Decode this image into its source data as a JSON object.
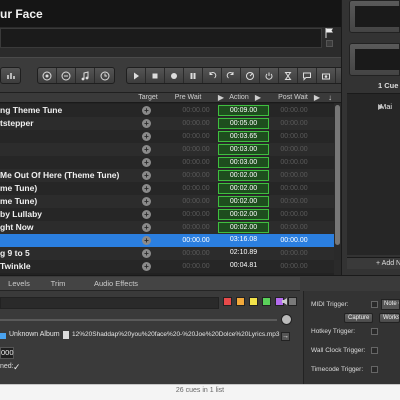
{
  "cue_title": "ur Face",
  "toolbar": {
    "groups": [
      [
        "equalizer-icon"
      ],
      [
        "target-icon",
        "audio-icon",
        "music-note-icon",
        "clock-icon"
      ],
      [
        "play-icon",
        "stop-icon",
        "record-icon",
        "pause-icon",
        "undo-icon",
        "redo-icon",
        "devamp-icon",
        "power-icon",
        "timer-icon",
        "chat-icon",
        "camera-icon",
        "script-icon"
      ]
    ]
  },
  "table": {
    "headers": {
      "target": "Target",
      "pre_wait": "Pre Wait",
      "action": "Action",
      "post_wait": "Post Wait"
    },
    "rows": [
      {
        "name": "ng Theme Tune",
        "pre": "00:00.00",
        "action": "00:09.00",
        "post": "00:00.00",
        "green": true,
        "selected": false
      },
      {
        "name": "tstepper",
        "pre": "00:00.00",
        "action": "00:05.00",
        "post": "00:00.00",
        "green": true,
        "selected": false
      },
      {
        "name": "",
        "pre": "00:00.00",
        "action": "00:03.65",
        "post": "00:00.00",
        "green": true,
        "selected": false
      },
      {
        "name": "",
        "pre": "00:00.00",
        "action": "00:03.00",
        "post": "00:00.00",
        "green": true,
        "selected": false
      },
      {
        "name": "",
        "pre": "00:00.00",
        "action": "00:03.00",
        "post": "00:00.00",
        "green": true,
        "selected": false
      },
      {
        "name": "Me Out Of Here (Theme Tune)",
        "pre": "00:00.00",
        "action": "00:02.00",
        "post": "00:00.00",
        "green": true,
        "selected": false
      },
      {
        "name": "me Tune)",
        "pre": "00:00.00",
        "action": "00:02.00",
        "post": "00:00.00",
        "green": true,
        "selected": false
      },
      {
        "name": "me Tune)",
        "pre": "00:00.00",
        "action": "00:02.00",
        "post": "00:00.00",
        "green": true,
        "selected": false
      },
      {
        "name": "by Lullaby",
        "pre": "00:00.00",
        "action": "00:02.00",
        "post": "00:00.00",
        "green": true,
        "selected": false
      },
      {
        "name": "ght Now",
        "pre": "00:00.00",
        "action": "00:02.00",
        "post": "00:00.00",
        "green": true,
        "selected": false
      },
      {
        "name": "",
        "pre": "00:00.00",
        "action": "03:16.08",
        "post": "00:00.00",
        "green": false,
        "selected": true
      },
      {
        "name": "g 9 to 5",
        "pre": "00:00.00",
        "action": "02:10.89",
        "post": "00:00.00",
        "green": false,
        "selected": false
      },
      {
        "name": "Twinkle",
        "pre": "00:00.00",
        "action": "00:04.81",
        "post": "00:00.00",
        "green": false,
        "selected": false
      }
    ]
  },
  "right_panel": {
    "cue_lists_label": "1 Cue L",
    "main_list": "Mai",
    "add_button": "+ Add N"
  },
  "inspector": {
    "tabs": [
      "Levels",
      "Trim",
      "Audio Effects"
    ],
    "swatch_colors": [
      "#e84a4a",
      "#f2a93b",
      "#f2e24a",
      "#5ad15a",
      "#b56cf0",
      "#7a7a7a"
    ],
    "album": "Unknown Album",
    "file_path": "12%20Shaddap%20you%20face%20-%20Joe%20Dolce%20Lyrics.mp3",
    "number_value": "000",
    "checkbox_label": "ned:",
    "file_arrow": "→"
  },
  "triggers": {
    "midi_label": "MIDI Trigger:",
    "midi_value": "Note O",
    "capture": "Capture",
    "workspace": "Works",
    "hotkey_label": "Hotkey Trigger:",
    "wallclock_label": "Wall Clock Trigger:",
    "timecode_label": "Timecode Trigger:"
  },
  "status": {
    "text": "26 cues in 1 list"
  }
}
